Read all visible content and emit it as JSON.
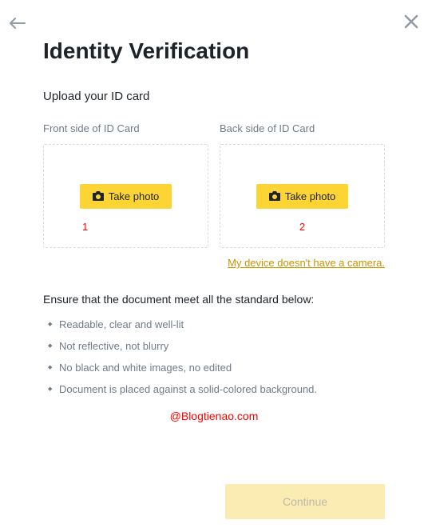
{
  "title": "Identity Verification",
  "subtitle": "Upload your ID card",
  "front": {
    "label": "Front side of ID Card",
    "button": "Take photo",
    "annotation": "1"
  },
  "back": {
    "label": "Back side of ID Card",
    "button": "Take photo",
    "annotation": "2"
  },
  "no_camera_link": "My device doesn't have a camera.",
  "ensure_title": "Ensure that the document meet all the standard below:",
  "requirements": {
    "r0": "Readable, clear and well-lit",
    "r1": "Not reflective, not blurry",
    "r2": "No black and white images, no edited",
    "r3": "Document is placed against a solid-colored background."
  },
  "watermark": "@Blogtienao.com",
  "continue_label": "Continue"
}
